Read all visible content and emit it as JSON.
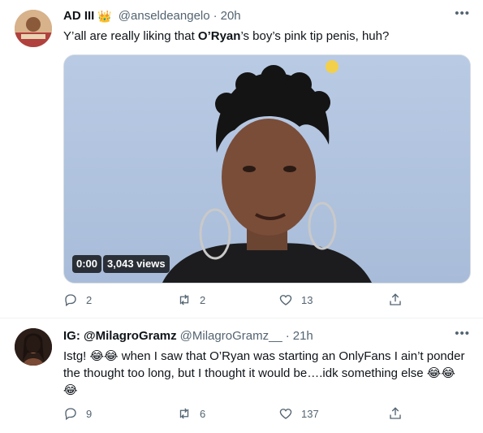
{
  "tweets": [
    {
      "display_name": "AD III",
      "badge_emoji": "👑",
      "handle": "@anseldeangelo",
      "separator": "·",
      "time": "20h",
      "text_before": "Y’all are really liking that ",
      "text_bold": "O’Ryan",
      "text_after": "’s boy’s pink tip penis, huh?",
      "media": {
        "timestamp": "0:00",
        "views": "3,043 views"
      },
      "actions": {
        "replies": "2",
        "retweets": "2",
        "likes": "13"
      }
    },
    {
      "display_name": "IG: @MilagroGramz",
      "handle": "@MilagroGramz__",
      "separator": "·",
      "time": "21h",
      "text": "Istg! 😂😂 when I saw that O’Ryan was starting an OnlyFans I ain’t ponder the thought too long, but I thought it would be….idk something else 😂😂 😂",
      "actions": {
        "replies": "9",
        "retweets": "6",
        "likes": "137"
      }
    }
  ],
  "icons": [
    "reply-icon",
    "retweet-icon",
    "like-icon",
    "share-icon",
    "more-icon"
  ],
  "colors": {
    "secondary_text": "#536471",
    "primary_text": "#0f1419"
  }
}
